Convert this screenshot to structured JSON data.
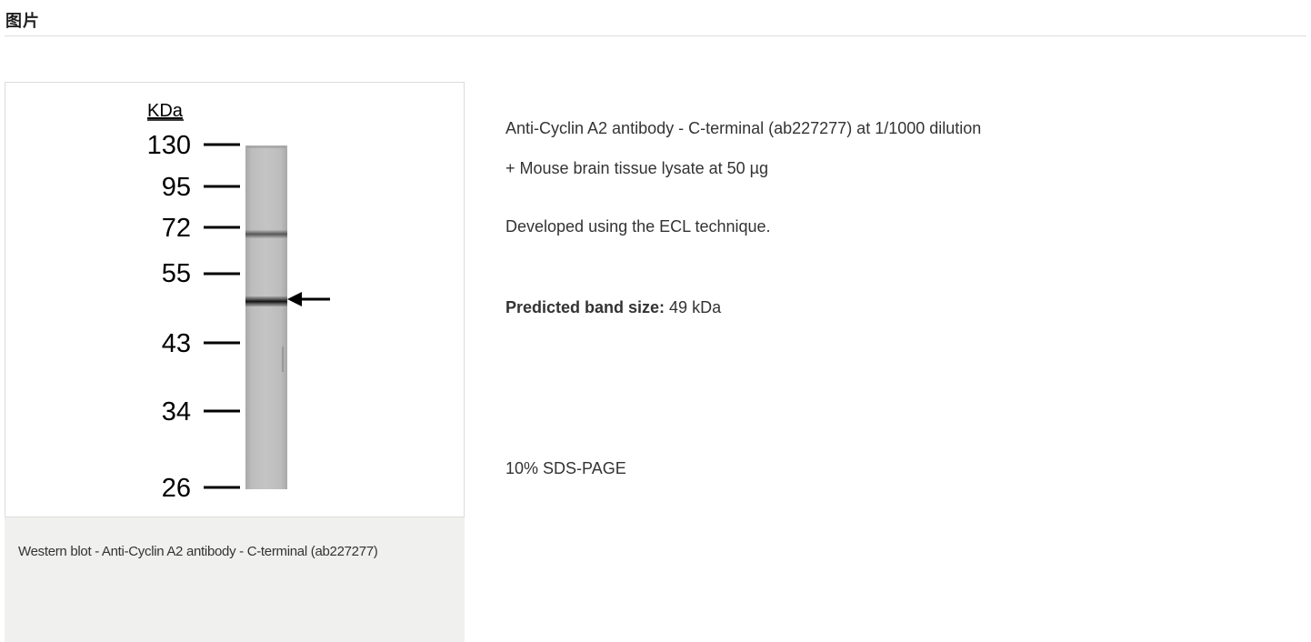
{
  "section": {
    "title": "图片"
  },
  "figure": {
    "blot": {
      "unit_label": "KDa",
      "markers": [
        "130",
        "95",
        "72",
        "55",
        "43",
        "34",
        "26"
      ]
    },
    "caption": "Western blot - Anti-Cyclin A2 antibody - C-terminal (ab227277)"
  },
  "details": {
    "antibody_line": "Anti-Cyclin A2 antibody - C-terminal (ab227277) at 1/1000 dilution",
    "lysate_line": "+ Mouse brain tissue lysate at 50 µg",
    "developed_line": "Developed using the ECL technique.",
    "band_label": "Predicted band size:",
    "band_value": " 49 kDa",
    "gel_line": "10% SDS-PAGE"
  }
}
